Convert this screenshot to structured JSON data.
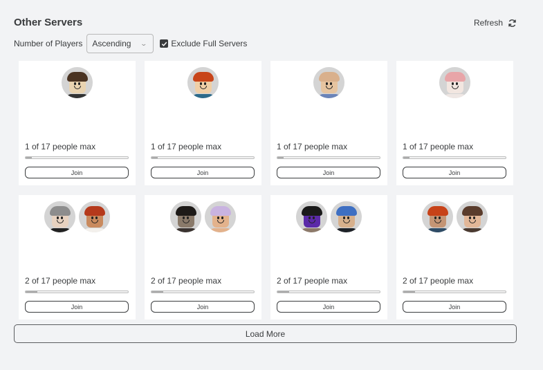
{
  "header": {
    "title": "Other Servers",
    "refresh_label": "Refresh"
  },
  "filters": {
    "sort_label": "Number of Players",
    "sort_value": "Ascending",
    "exclude_full_label": "Exclude Full Servers",
    "exclude_full_checked": true
  },
  "servers": [
    {
      "players_text": "1 of 17 people max",
      "players": 1,
      "max": 17,
      "join_label": "Join",
      "avatars": [
        {
          "skin": "#e9d3b0",
          "hair": "#4a3322",
          "shirt": "#333333"
        }
      ]
    },
    {
      "players_text": "1 of 17 people max",
      "players": 1,
      "max": 17,
      "join_label": "Join",
      "avatars": [
        {
          "skin": "#f0cfa6",
          "hair": "#c8451a",
          "shirt": "#2d6a8a"
        }
      ]
    },
    {
      "players_text": "1 of 17 people max",
      "players": 1,
      "max": 17,
      "join_label": "Join",
      "avatars": [
        {
          "skin": "#e6c4a0",
          "hair": "#d9b08c",
          "shirt": "#6b84b8"
        }
      ]
    },
    {
      "players_text": "1 of 17 people max",
      "players": 1,
      "max": 17,
      "join_label": "Join",
      "avatars": [
        {
          "skin": "#f2e6e0",
          "hair": "#e8a5a8",
          "shirt": "#efe7e4"
        }
      ]
    },
    {
      "players_text": "2 of 17 people max",
      "players": 2,
      "max": 17,
      "join_label": "Join",
      "avatars": [
        {
          "skin": "#e7d2c0",
          "hair": "#8d8d8d",
          "shirt": "#222222"
        },
        {
          "skin": "#c98a5e",
          "hair": "#b5391b",
          "shirt": "#f3f0ec"
        }
      ]
    },
    {
      "players_text": "2 of 17 people max",
      "players": 2,
      "max": 17,
      "join_label": "Join",
      "avatars": [
        {
          "skin": "#8a7a6a",
          "hair": "#1d1a18",
          "shirt": "#3a3330"
        },
        {
          "skin": "#e3b28c",
          "hair": "#c9b3e0",
          "shirt": "#e3b28c"
        }
      ]
    },
    {
      "players_text": "2 of 17 people max",
      "players": 2,
      "max": 17,
      "join_label": "Join",
      "avatars": [
        {
          "skin": "#5b2aa8",
          "hair": "#1a1a1a",
          "shirt": "#8d7a6a"
        },
        {
          "skin": "#d7b08c",
          "hair": "#3e6fc2",
          "shirt": "#1e2228"
        }
      ]
    },
    {
      "players_text": "2 of 17 people max",
      "players": 2,
      "max": 17,
      "join_label": "Join",
      "avatars": [
        {
          "skin": "#c49575",
          "hair": "#c74218",
          "shirt": "#2f4c66"
        },
        {
          "skin": "#e2b798",
          "hair": "#5a3c2c",
          "shirt": "#4a3a30"
        }
      ]
    }
  ],
  "load_more_label": "Load More",
  "colors": {
    "background": "#f2f3f5",
    "card": "#ffffff",
    "text": "#393b3d",
    "progress_fill": "#aaaaaa"
  }
}
